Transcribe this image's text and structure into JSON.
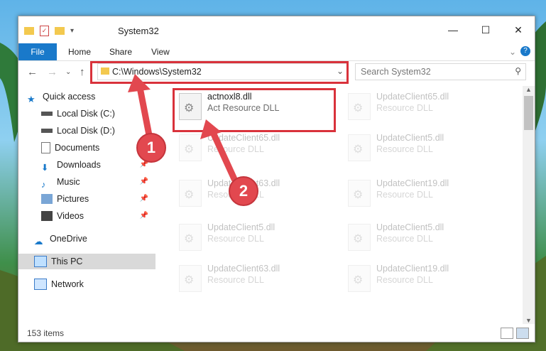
{
  "window": {
    "title": "System32"
  },
  "ribbon": {
    "tabs": [
      "File",
      "Home",
      "Share",
      "View"
    ]
  },
  "nav": {
    "address": "C:\\Windows\\System32",
    "search_placeholder": "Search System32"
  },
  "sidebar": {
    "quick_access": "Quick access",
    "items": [
      "Local Disk (C:)",
      "Local Disk (D:)",
      "Documents",
      "Downloads",
      "Music",
      "Pictures",
      "Videos"
    ],
    "onedrive": "OneDrive",
    "this_pc": "This PC",
    "network": "Network"
  },
  "files": [
    {
      "name": "actnoxl8.dll",
      "type": "Act Resource DLL"
    },
    {
      "name": "UpdateClient65.dll",
      "type": "Resource DLL"
    },
    {
      "name": "UpdateClient65.dll",
      "type": "Resource DLL"
    },
    {
      "name": "UpdateClient5.dll",
      "type": "Resource DLL"
    },
    {
      "name": "UpdateClient63.dll",
      "type": "Resource DLL"
    },
    {
      "name": "UpdateClient19.dll",
      "type": "Resource DLL"
    },
    {
      "name": "UpdateClient5.dll",
      "type": "Resource DLL"
    },
    {
      "name": "UpdateClient5.dll",
      "type": "Resource DLL"
    },
    {
      "name": "UpdateClient63.dll",
      "type": "Resource DLL"
    },
    {
      "name": "UpdateClient19.dll",
      "type": "Resource DLL"
    }
  ],
  "status": {
    "count": "153 items"
  },
  "annotations": {
    "step1": "1",
    "step2": "2"
  },
  "colors": {
    "accent": "#1979ca",
    "highlight": "#d9323b"
  }
}
